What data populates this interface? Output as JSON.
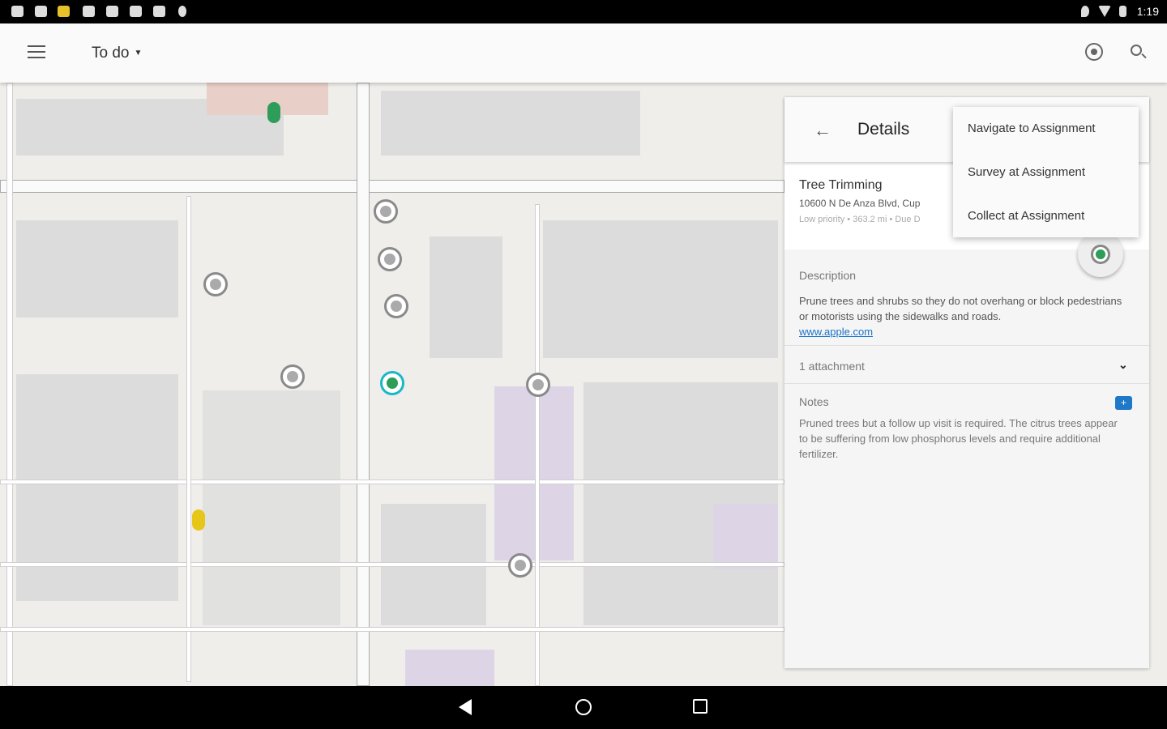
{
  "status_bar": {
    "time": "1:19",
    "icons": [
      "notification-icon",
      "mail-icon",
      "ticket-icon",
      "phone-icon",
      "briefcase-icon",
      "briefcase-icon",
      "photos-icon",
      "lightbulb-icon"
    ],
    "right_icons": [
      "location-icon",
      "wifi-icon",
      "battery-icon"
    ]
  },
  "app_bar": {
    "title": "To do",
    "menu_icon": "hamburger-icon",
    "actions": [
      "locate-icon",
      "search-icon"
    ]
  },
  "details": {
    "title": "Details",
    "name": "Tree Trimming",
    "address": "10600 N De Anza Blvd, Cup",
    "meta": "Low priority • 363.2 mi • Due D",
    "description_label": "Description",
    "description": "Prune trees and shrubs so they do not overhang or block pedestrians or motorists using the sidewalks and roads.",
    "link": "www.apple.com",
    "attachments": "1 attachment",
    "notes_label": "Notes",
    "notes": "Pruned trees but a follow up visit is required. The citrus trees appear to be suffering from low phosphorus levels and require additional fertilizer."
  },
  "overflow_menu": [
    "Navigate to Assignment",
    "Survey at Assignment",
    "Collect at Assignment"
  ],
  "colors": {
    "selected_marker": "#2e9d59",
    "selected_ring": "#19b8c8",
    "link": "#1a73c8",
    "pin_green": "#2e9d59",
    "pin_yellow": "#e6c619"
  }
}
